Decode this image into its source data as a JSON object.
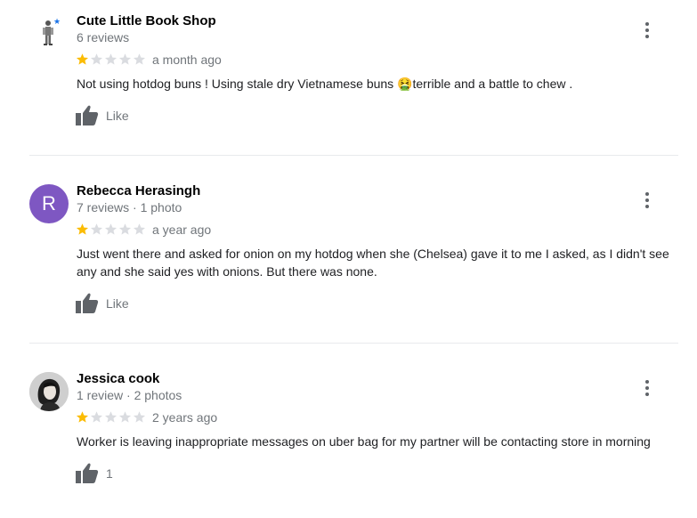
{
  "reviews": [
    {
      "name": "Cute Little Book Shop",
      "meta": "6 reviews",
      "rating": 1,
      "max_rating": 5,
      "time": "a month ago",
      "text": "Not using hotdog buns ! Using stale dry Vietnamese buns 🤮terrible and a battle to chew .",
      "like_label": "Like",
      "avatar_icon": "robot-figure-icon"
    },
    {
      "name": "Rebecca Herasingh",
      "meta": "7 reviews · 1 photo",
      "rating": 1,
      "max_rating": 5,
      "time": "a year ago",
      "text": "Just went there and asked for onion on my hotdog when she (Chelsea) gave it to me I asked, as I didn't see any and she said yes with onions. But there was none.",
      "like_label": "Like",
      "avatar_letter": "R",
      "avatar_color": "#7e57c2"
    },
    {
      "name": "Jessica cook",
      "meta": "1 review · 2 photos",
      "rating": 1,
      "max_rating": 5,
      "time": "2 years ago",
      "text": "Worker is leaving inappropriate messages on uber bag for my partner will be contacting store in morning",
      "like_label": "1",
      "avatar_icon": "portrait-photo-icon"
    }
  ],
  "colors": {
    "star_filled": "#fbbc04",
    "star_empty": "#dadce0",
    "secondary_text": "#70757a",
    "icon": "#5f6368"
  }
}
